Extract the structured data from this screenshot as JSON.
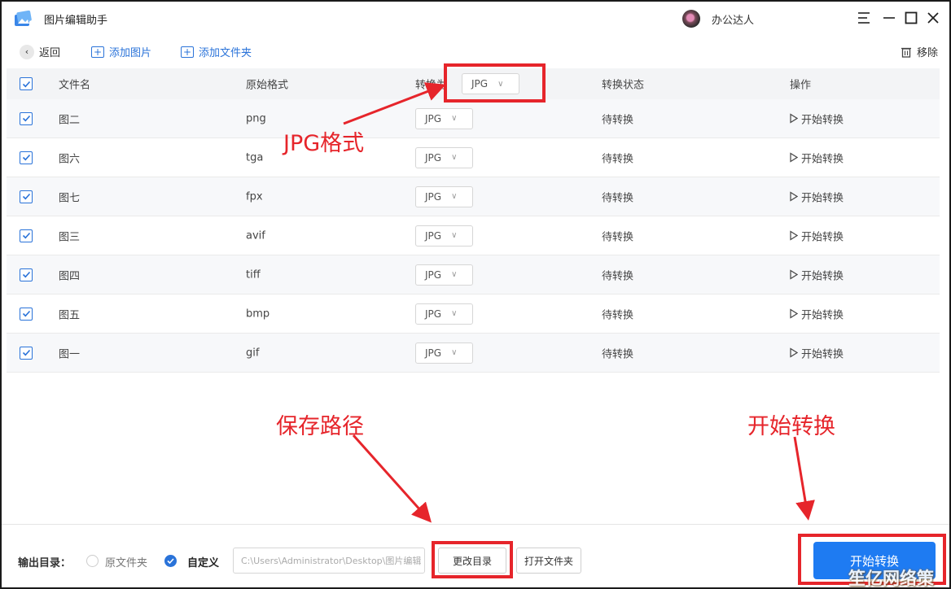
{
  "app": {
    "title": "图片编辑助手",
    "username": "办公达人"
  },
  "toolbar": {
    "back": "返回",
    "add_image": "添加图片",
    "add_folder": "添加文件夹",
    "remove": "移除"
  },
  "table": {
    "headers": {
      "name": "文件名",
      "original_format": "原始格式",
      "convert_to": "转换为",
      "status": "转换状态",
      "action": "操作"
    },
    "header_format": "JPG",
    "rows": [
      {
        "name": "图二",
        "format": "png",
        "target": "JPG",
        "status": "待转换",
        "action": "开始转换"
      },
      {
        "name": "图六",
        "format": "tga",
        "target": "JPG",
        "status": "待转换",
        "action": "开始转换"
      },
      {
        "name": "图七",
        "format": "fpx",
        "target": "JPG",
        "status": "待转换",
        "action": "开始转换"
      },
      {
        "name": "图三",
        "format": "avif",
        "target": "JPG",
        "status": "待转换",
        "action": "开始转换"
      },
      {
        "name": "图四",
        "format": "tiff",
        "target": "JPG",
        "status": "待转换",
        "action": "开始转换"
      },
      {
        "name": "图五",
        "format": "bmp",
        "target": "JPG",
        "status": "待转换",
        "action": "开始转换"
      },
      {
        "name": "图一",
        "format": "gif",
        "target": "JPG",
        "status": "待转换",
        "action": "开始转换"
      }
    ]
  },
  "bottom": {
    "output_label": "输出目录：",
    "option_original": "原文件夹",
    "option_custom": "自定义",
    "path_value": "C:\\Users\\Administrator\\Desktop\\图片编辑",
    "change_dir": "更改目录",
    "open_folder": "打开文件夹",
    "start": "开始转换"
  },
  "annotations": {
    "jpg_format": "JPG格式",
    "save_path": "保存路径",
    "start_convert": "开始转换"
  },
  "watermark": "笙亿网络策划",
  "colors": {
    "accent": "#1e7bf2",
    "annotation": "#e6252b"
  }
}
